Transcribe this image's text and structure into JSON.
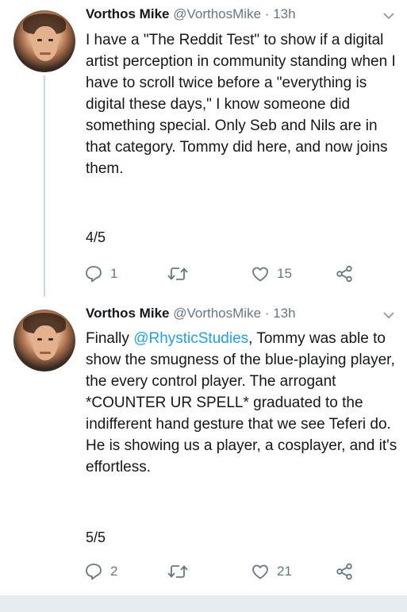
{
  "tweets": [
    {
      "name": "Vorthos Mike",
      "handle": "@VorthosMike",
      "separator": "·",
      "time": "13h",
      "text": "I have a \"The Reddit Test\" to show if a digital artist perception in community standing when I have to scroll twice before a \"everything is digital these days,\" I know someone did something special. Only Seb and Nils are in that category. Tommy did here, and now joins them.",
      "thread_count": "4/5",
      "replies": "1",
      "retweets": "",
      "likes": "15"
    },
    {
      "name": "Vorthos Mike",
      "handle": "@VorthosMike",
      "separator": "·",
      "time": "13h",
      "text_before": "Finally ",
      "mention": "@RhysticStudies",
      "text_after": ", Tommy was able to show the smugness of the blue-playing player, the every control player. The arrogant *COUNTER UR SPELL* graduated to the indifferent hand gesture that we see Teferi do. He is showing us a player, a cosplayer, and it's effortless.",
      "thread_count": "5/5",
      "replies": "2",
      "retweets": "",
      "likes": "21"
    }
  ],
  "icons": {
    "reply": "reply-icon",
    "retweet": "retweet-icon",
    "like": "heart-icon",
    "share": "share-icon",
    "menu": "chevron-down-icon"
  },
  "colors": {
    "link": "#1da1f2",
    "secondary_text": "#657786",
    "thread_line": "#ccd6dd"
  }
}
